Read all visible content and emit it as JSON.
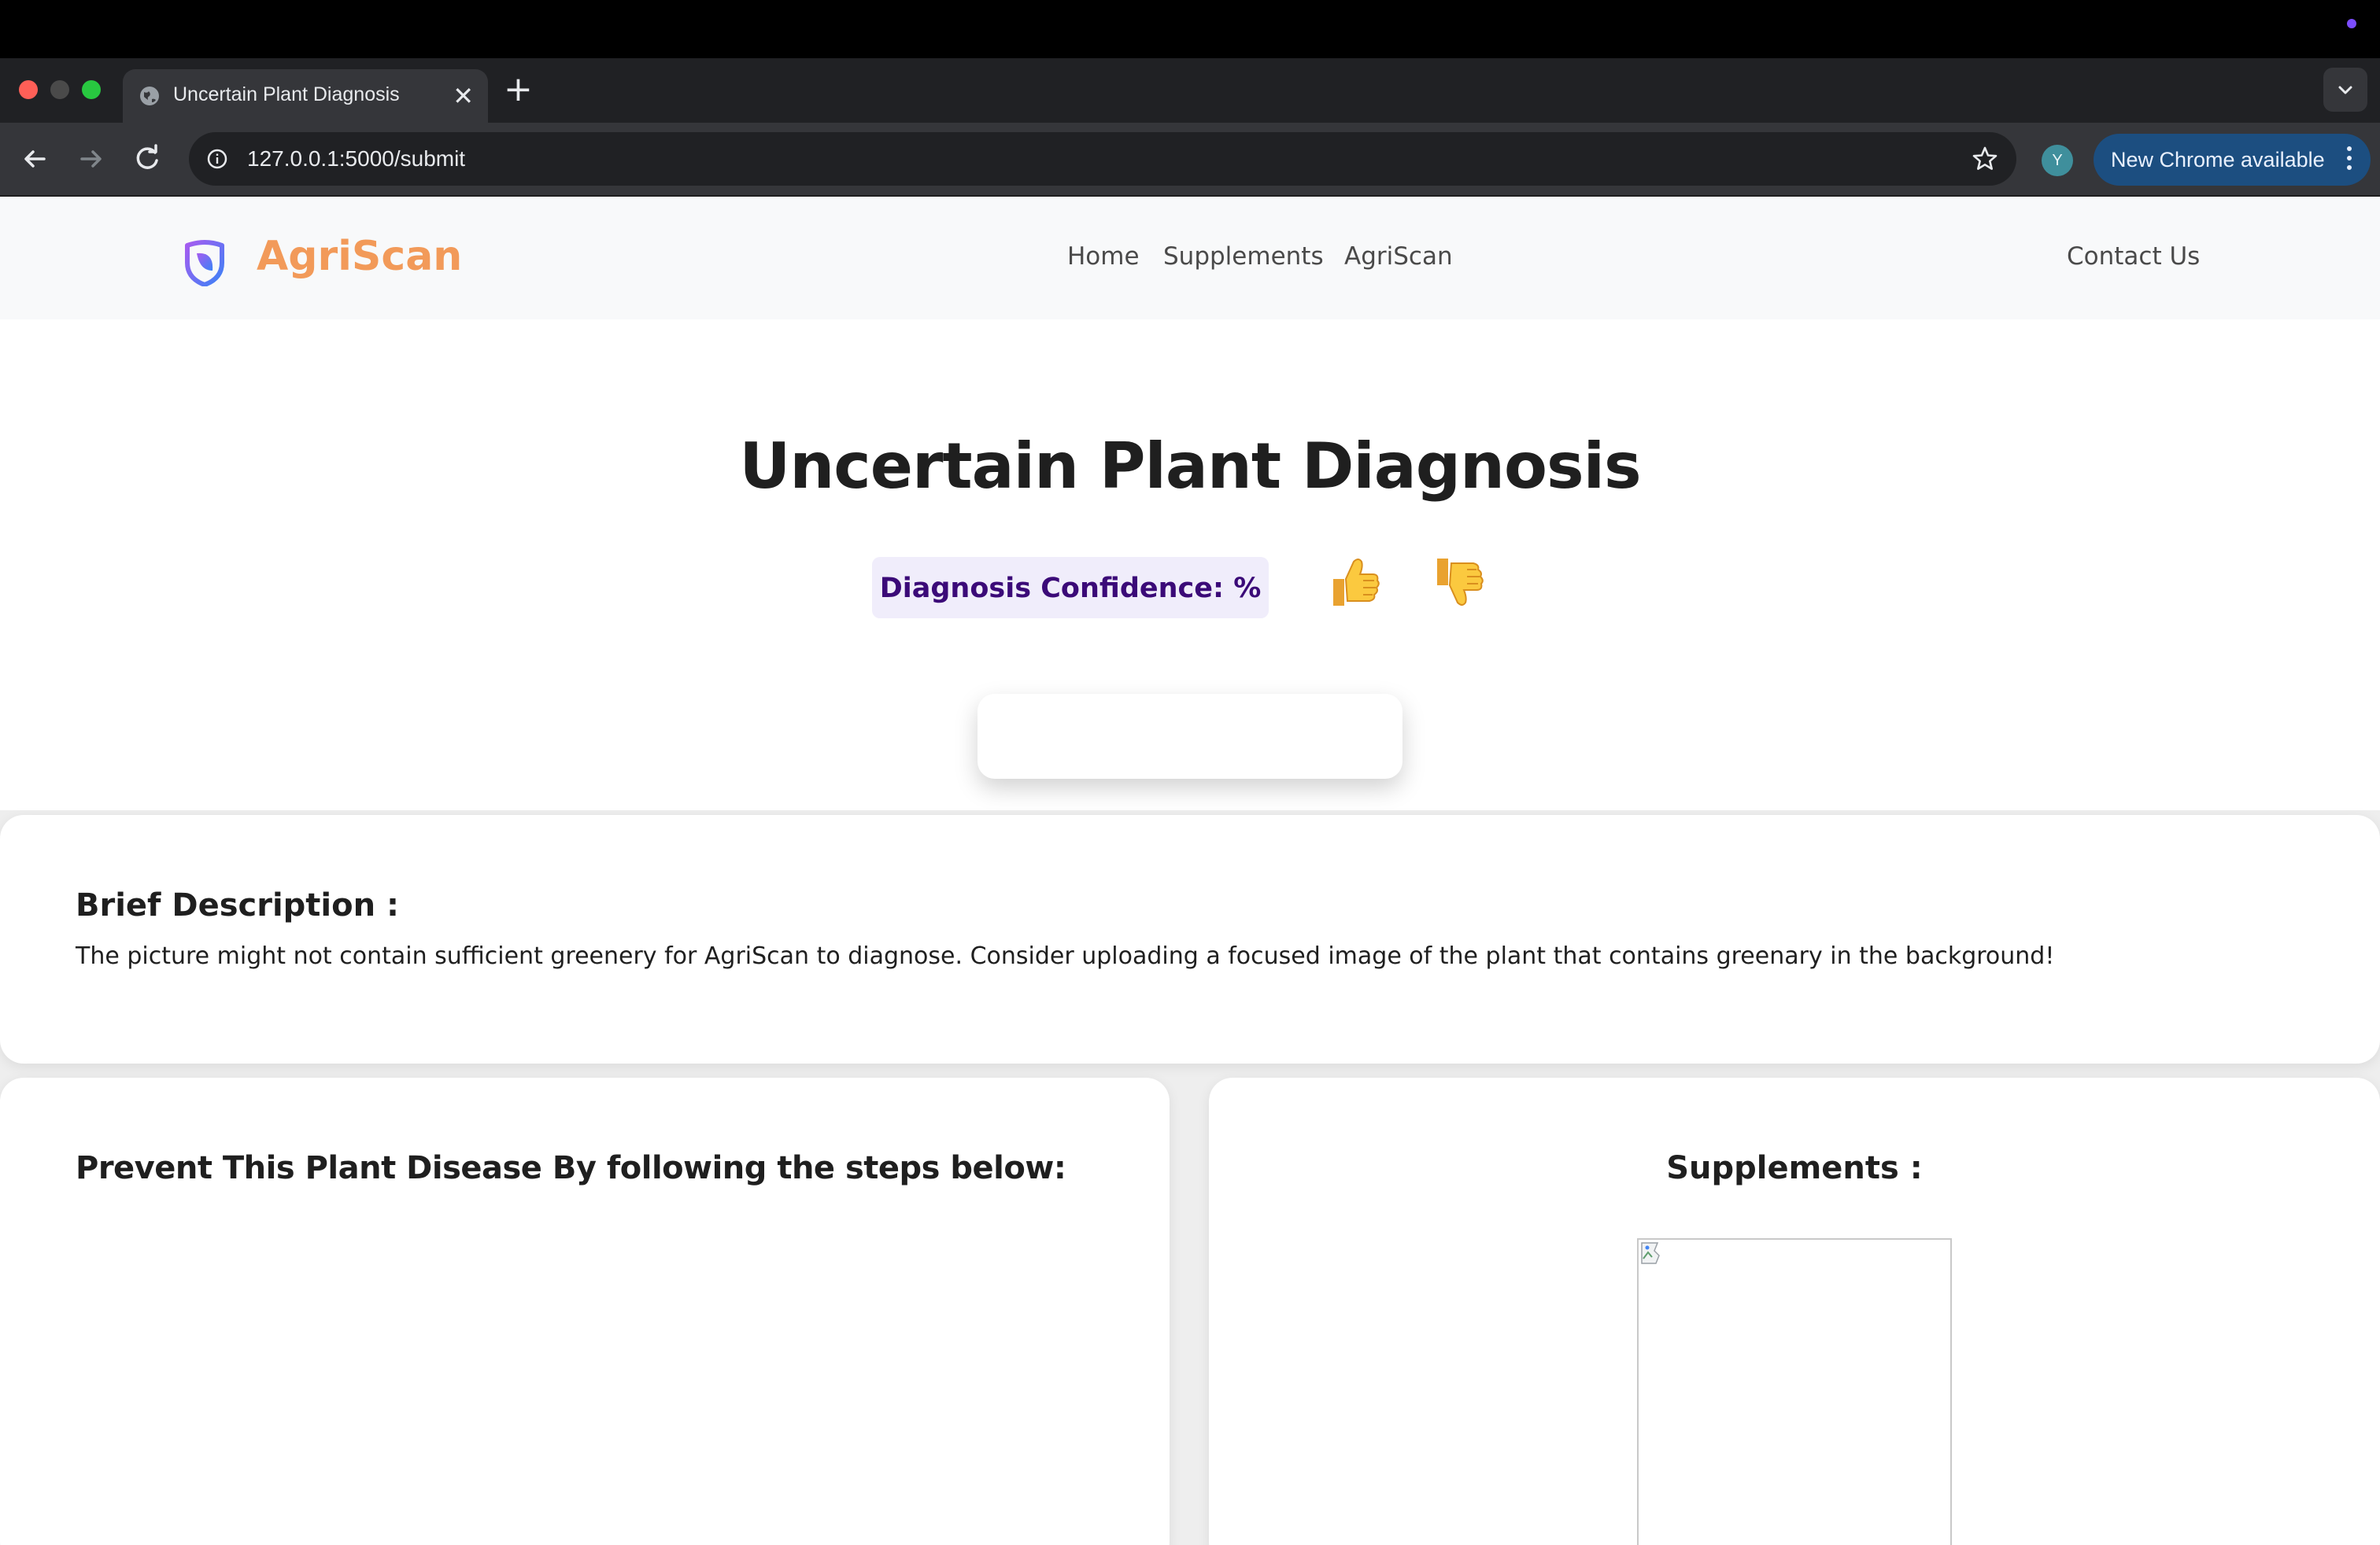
{
  "browser": {
    "tab": {
      "title": "Uncertain Plant Diagnosis",
      "close_glyph": "✕",
      "favicon": "globe-icon"
    },
    "new_tab_glyph": "+",
    "address": {
      "url": "127.0.0.1:5000/submit"
    },
    "profile_initial": "Y",
    "update_pill": {
      "label": "New Chrome available"
    },
    "colors": {
      "tab_bar": "#202124",
      "toolbar": "#35363a",
      "update_pill": "#1c4e80"
    }
  },
  "site": {
    "brand": {
      "name": "AgriScan",
      "color": "#f29a59",
      "logo": "leaf-shield-icon"
    },
    "nav": [
      {
        "label": "Home"
      },
      {
        "label": "Supplements"
      },
      {
        "label": "AgriScan"
      }
    ],
    "contact_label": "Contact Us"
  },
  "main": {
    "title": "Uncertain Plant Diagnosis",
    "confidence_label": "Diagnosis Confidence: %",
    "confidence_color": "#3b0a78",
    "feedback": {
      "up_emoji": "👍",
      "down_emoji": "👎"
    }
  },
  "description": {
    "heading": "Brief Description :",
    "text": "The picture might not contain sufficient greenery for AgriScan to diagnose. Consider uploading a focused image of the plant that contains greenary in the background!"
  },
  "prevention": {
    "heading": "Prevent This Plant Disease By following the steps below:"
  },
  "supplements": {
    "heading": "Supplements :"
  }
}
